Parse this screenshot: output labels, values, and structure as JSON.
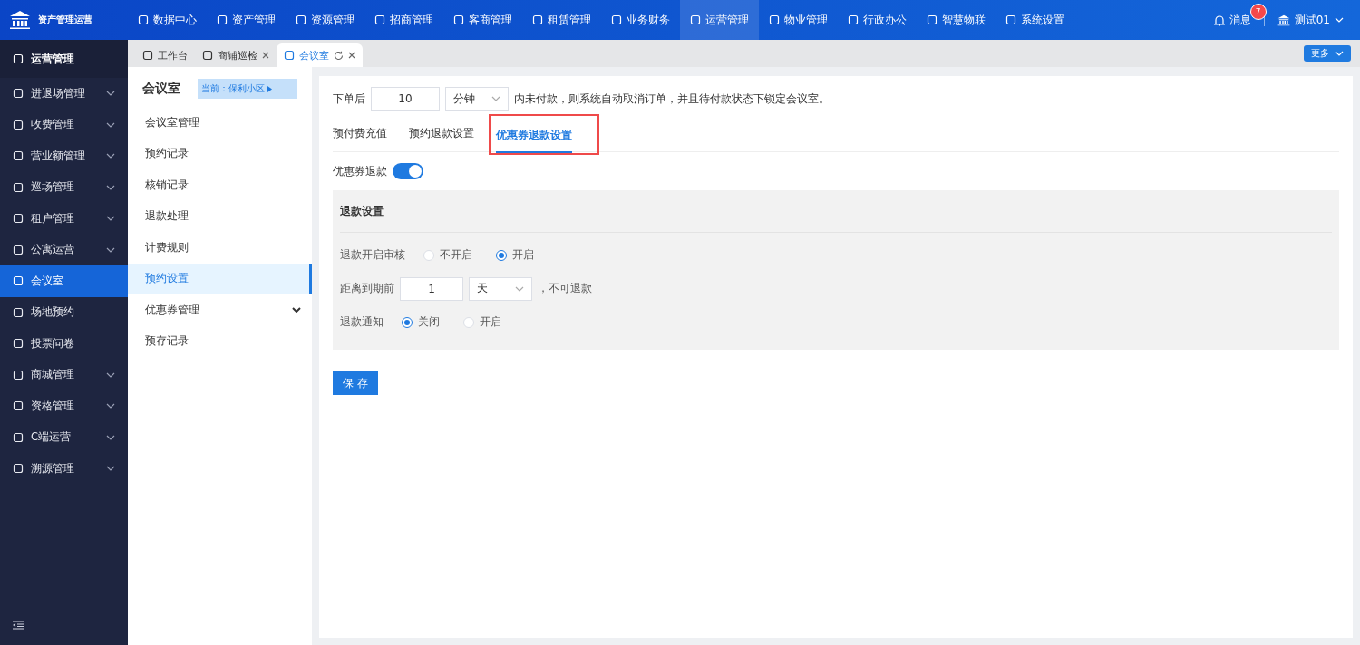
{
  "app": {
    "title": "资产管理运营"
  },
  "top_nav": [
    {
      "label": "数据中心",
      "selected": false
    },
    {
      "label": "资产管理",
      "selected": false
    },
    {
      "label": "资源管理",
      "selected": false
    },
    {
      "label": "招商管理",
      "selected": false
    },
    {
      "label": "客商管理",
      "selected": false
    },
    {
      "label": "租赁管理",
      "selected": false
    },
    {
      "label": "业务财务",
      "selected": false
    },
    {
      "label": "运营管理",
      "selected": true
    },
    {
      "label": "物业管理",
      "selected": false
    },
    {
      "label": "行政办公",
      "selected": false
    },
    {
      "label": "智慧物联",
      "selected": false
    },
    {
      "label": "系统设置",
      "selected": false
    }
  ],
  "header_right": {
    "messages": "消息",
    "message_count": "7",
    "user": "测试01"
  },
  "sidebar": {
    "title": "运营管理",
    "items": [
      {
        "label": "进退场管理",
        "selected": false,
        "expandable": true
      },
      {
        "label": "收费管理",
        "selected": false,
        "expandable": true
      },
      {
        "label": "营业额管理",
        "selected": false,
        "expandable": true
      },
      {
        "label": "巡场管理",
        "selected": false,
        "expandable": true
      },
      {
        "label": "租户管理",
        "selected": false,
        "expandable": true
      },
      {
        "label": "公寓运营",
        "selected": false,
        "expandable": true
      },
      {
        "label": "会议室",
        "selected": true,
        "expandable": false
      },
      {
        "label": "场地预约",
        "selected": false,
        "expandable": false
      },
      {
        "label": "投票问卷",
        "selected": false,
        "expandable": false
      },
      {
        "label": "商城管理",
        "selected": false,
        "expandable": true
      },
      {
        "label": "资格管理",
        "selected": false,
        "expandable": true
      },
      {
        "label": "C端运营",
        "selected": false,
        "expandable": true
      },
      {
        "label": "溯源管理",
        "selected": false,
        "expandable": true
      }
    ]
  },
  "page_tabs": [
    {
      "label": "工作台",
      "selected": false,
      "closable": false
    },
    {
      "label": "商铺巡检",
      "selected": false,
      "closable": true
    },
    {
      "label": "会议室",
      "selected": true,
      "closable": true
    }
  ],
  "more_button": "更多",
  "submenu": {
    "title": "会议室",
    "location": "当前：保利小区",
    "items": [
      {
        "label": "会议室管理",
        "selected": false,
        "expandable": false
      },
      {
        "label": "预约记录",
        "selected": false,
        "expandable": false
      },
      {
        "label": "核销记录",
        "selected": false,
        "expandable": false
      },
      {
        "label": "退款处理",
        "selected": false,
        "expandable": false
      },
      {
        "label": "计费规则",
        "selected": false,
        "expandable": false
      },
      {
        "label": "预约设置",
        "selected": true,
        "expandable": false
      },
      {
        "label": "优惠券管理",
        "selected": false,
        "expandable": true
      },
      {
        "label": "预存记录",
        "selected": false,
        "expandable": false
      }
    ]
  },
  "order_rule": {
    "prefix": "下单后",
    "value": "10",
    "unit": "分钟",
    "suffix": "内未付款，则系统自动取消订单，并且待付款状态下锁定会议室。"
  },
  "settings_tabs": [
    {
      "label": "预付费充值",
      "selected": false,
      "highlighted": false
    },
    {
      "label": "预约退款设置",
      "selected": false,
      "highlighted": false
    },
    {
      "label": "优惠券退款设置",
      "selected": true,
      "highlighted": true
    }
  ],
  "coupon_refund": {
    "label": "优惠券退款",
    "on": true
  },
  "refund_settings": {
    "title": "退款设置",
    "review": {
      "label": "退款开启审核",
      "options": [
        {
          "label": "不开启",
          "selected": false
        },
        {
          "label": "开启",
          "selected": true
        }
      ]
    },
    "deadline": {
      "label": "距离到期前",
      "value": "1",
      "unit": "天",
      "suffix": "，不可退款"
    },
    "notify": {
      "label": "退款通知",
      "options": [
        {
          "label": "关闭",
          "selected": true
        },
        {
          "label": "开启",
          "selected": false
        }
      ]
    }
  },
  "save_button": "保 存"
}
